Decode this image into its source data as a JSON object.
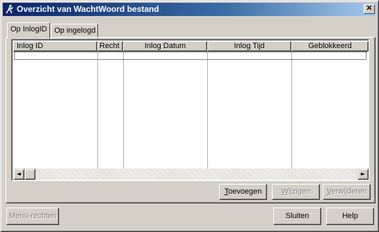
{
  "window": {
    "title": "Overzicht van WachtWoord bestand",
    "close_glyph": "✕",
    "app_icon": "runner-icon"
  },
  "tabs": [
    {
      "label": "Op InlogID",
      "active": true
    },
    {
      "label": "Op ingelogd",
      "active": false
    }
  ],
  "table": {
    "columns": [
      "Inlog ID",
      "Recht",
      "Inlog Datum",
      "Inlog Tijd",
      "Geblokkeerd"
    ],
    "rows": []
  },
  "scrollbar": {
    "left_icon": "◄",
    "right_icon": "►"
  },
  "buttons": {
    "toevoegen": {
      "mnemonic": "T",
      "rest": "oevoegen",
      "enabled": true
    },
    "wijzigen": {
      "mnemonic": "W",
      "rest": "ijzigen",
      "enabled": false
    },
    "verwijderen": {
      "mnemonic": "V",
      "rest": "erwijderen",
      "enabled": false
    },
    "menu_rechten": {
      "label": "Menu-rechten",
      "enabled": false
    },
    "sluiten": {
      "label": "Sluiten",
      "enabled": true
    },
    "help": {
      "label": "Help",
      "enabled": true
    }
  },
  "colors": {
    "title_gradient_start": "#0a246a",
    "title_gradient_end": "#a6caf0",
    "face": "#d4d0c8",
    "disabled_text": "#808080"
  }
}
